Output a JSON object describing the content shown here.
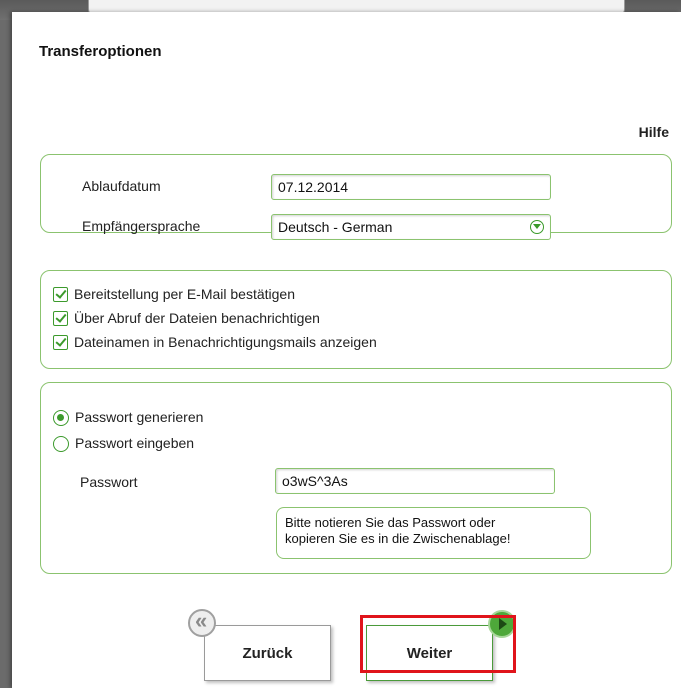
{
  "dialog": {
    "title": "Transferoptionen",
    "help_label": "Hilfe"
  },
  "expiry": {
    "label": "Ablaufdatum",
    "value": "07.12.2014"
  },
  "language": {
    "label": "Empfängersprache",
    "value": "Deutsch - German"
  },
  "checkboxes": [
    {
      "label": "Bereitstellung per E-Mail bestätigen",
      "checked": true
    },
    {
      "label": "Über Abruf der Dateien benachrichtigen",
      "checked": true
    },
    {
      "label": "Dateinamen in Benachrichtigungsmails anzeigen",
      "checked": true
    }
  ],
  "password_mode": [
    {
      "label": "Passwort generieren",
      "selected": true
    },
    {
      "label": "Passwort eingeben",
      "selected": false
    }
  ],
  "password": {
    "label": "Passwort",
    "value": "o3wS^3As",
    "note_line1": "Bitte notieren Sie das Passwort oder",
    "note_line2": "kopieren Sie es in die Zwischenablage!"
  },
  "nav": {
    "back_label": "Zurück",
    "next_label": "Weiter"
  },
  "colors": {
    "accent_green": "#3c9a2c",
    "border_green": "#8bc36f",
    "highlight_red": "#e0141b"
  }
}
